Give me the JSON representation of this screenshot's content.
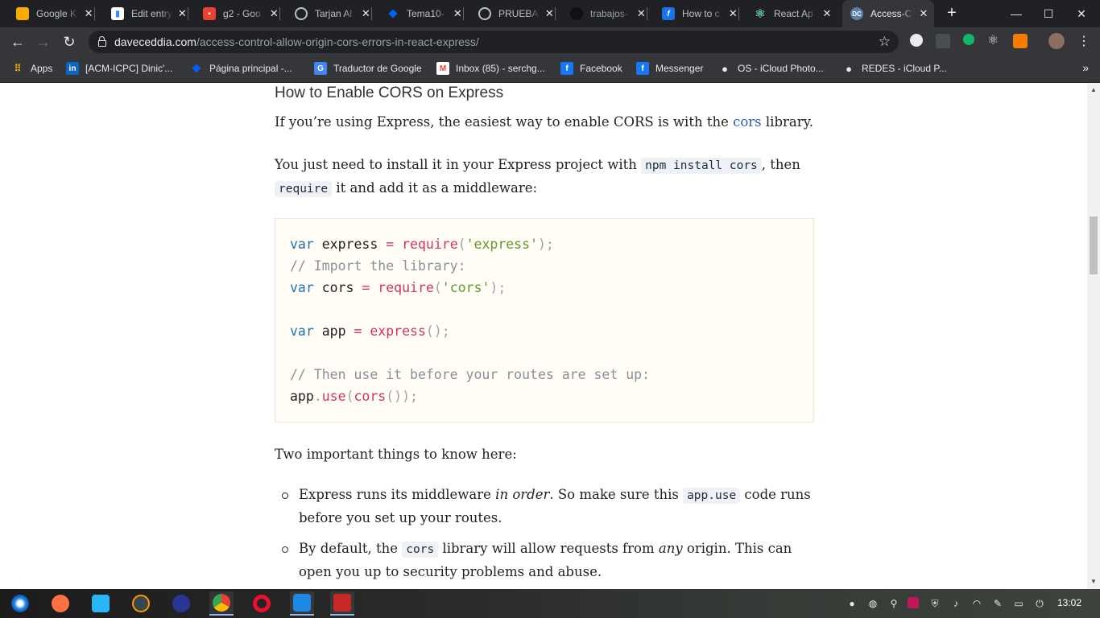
{
  "browser": {
    "tabs": [
      {
        "title": "Google K",
        "icon": "keep-icon",
        "color": "#f9ab00",
        "active": false
      },
      {
        "title": "Edit entry",
        "icon": "analytics-icon",
        "color": "#4285f4",
        "active": false
      },
      {
        "title": "g2 - Goo",
        "icon": "g2-icon",
        "color": "#e94235",
        "active": false
      },
      {
        "title": "Tarjan Al",
        "icon": "globe-icon",
        "color": "#9aa0a6",
        "active": false
      },
      {
        "title": "Tema10-",
        "icon": "dropbox-icon",
        "color": "#0061fe",
        "active": false
      },
      {
        "title": "PRUEBA",
        "icon": "globe-icon",
        "color": "#9aa0a6",
        "active": false
      },
      {
        "title": "trabajos-",
        "icon": "github-icon",
        "color": "#24292e",
        "active": false
      },
      {
        "title": "How to c",
        "icon": "fcc-icon",
        "color": "#1a73e8",
        "active": false
      },
      {
        "title": "React Ap",
        "icon": "react-icon",
        "color": "#61dafb",
        "active": false
      },
      {
        "title": "Access-C",
        "icon": "dc-icon",
        "color": "#5b7fa6",
        "active": true
      }
    ],
    "url_host": "daveceddia.com",
    "url_path": "/access-control-allow-origin-cors-errors-in-react-express/",
    "bookmarks": [
      {
        "label": "Apps",
        "icon": "apps-grid-icon"
      },
      {
        "label": "[ACM-ICPC] Dinic'...",
        "icon": "linkedin-icon"
      },
      {
        "label": "Página principal -...",
        "icon": "dropbox-icon"
      },
      {
        "label": "Traductor de Google",
        "icon": "translate-icon"
      },
      {
        "label": "Inbox (85) - serchg...",
        "icon": "gmail-icon"
      },
      {
        "label": "Facebook",
        "icon": "facebook-icon"
      },
      {
        "label": "Messenger",
        "icon": "facebook-icon"
      },
      {
        "label": "OS - iCloud Photo...",
        "icon": "apple-icon"
      },
      {
        "label": "REDES - iCloud P...",
        "icon": "apple-icon"
      }
    ]
  },
  "article": {
    "heading": "How to Enable CORS on Express",
    "p1_before": "If you’re using Express, the easiest way to enable CORS is with the ",
    "p1_link": "cors",
    "p1_after": " library.",
    "p2_a": "You just need to install it in your Express project with ",
    "p2_code1": "npm install cors",
    "p2_b": ", then",
    "p2_code2": "require",
    "p2_c": " it and add it as a middleware:",
    "code_lines": {
      "l1_kw": "var",
      "l1_id": " express ",
      "l1_op": "=",
      "l1_fn": " require",
      "l1_p1": "(",
      "l1_str": "'express'",
      "l1_p2": ");",
      "l2_cm": "// Import the library:",
      "l3_kw": "var",
      "l3_id": " cors ",
      "l3_op": "=",
      "l3_fn": " require",
      "l3_p1": "(",
      "l3_str": "'cors'",
      "l3_p2": ");",
      "l5_kw": "var",
      "l5_id": " app ",
      "l5_op": "=",
      "l5_fn": " express",
      "l5_p": "();",
      "l7_cm": "// Then use it before your routes are set up:",
      "l8_id": "app",
      "l8_dot": ".",
      "l8_fn": "use",
      "l8_p1": "(",
      "l8_fn2": "cors",
      "l8_p2": "());"
    },
    "p3": "Two important things to know here:",
    "li1_a": "Express runs its middleware ",
    "li1_em": "in order",
    "li1_b": ". So make sure this ",
    "li1_code": "app.use",
    "li1_c": " code runs before you set up your routes.",
    "li2_a": "By default, the ",
    "li2_code": "cors",
    "li2_b": " library will allow requests from ",
    "li2_em": "any",
    "li2_c": " origin. This can open you up to security problems and abuse."
  },
  "taskbar": {
    "clock": "13:02",
    "apps": [
      "deepin-launcher-icon",
      "screen-recorder-icon",
      "store-icon",
      "sublime-icon",
      "monitor-icon",
      "chrome-icon",
      "opera-icon",
      "vscode-icon",
      "terminal-icon"
    ]
  }
}
